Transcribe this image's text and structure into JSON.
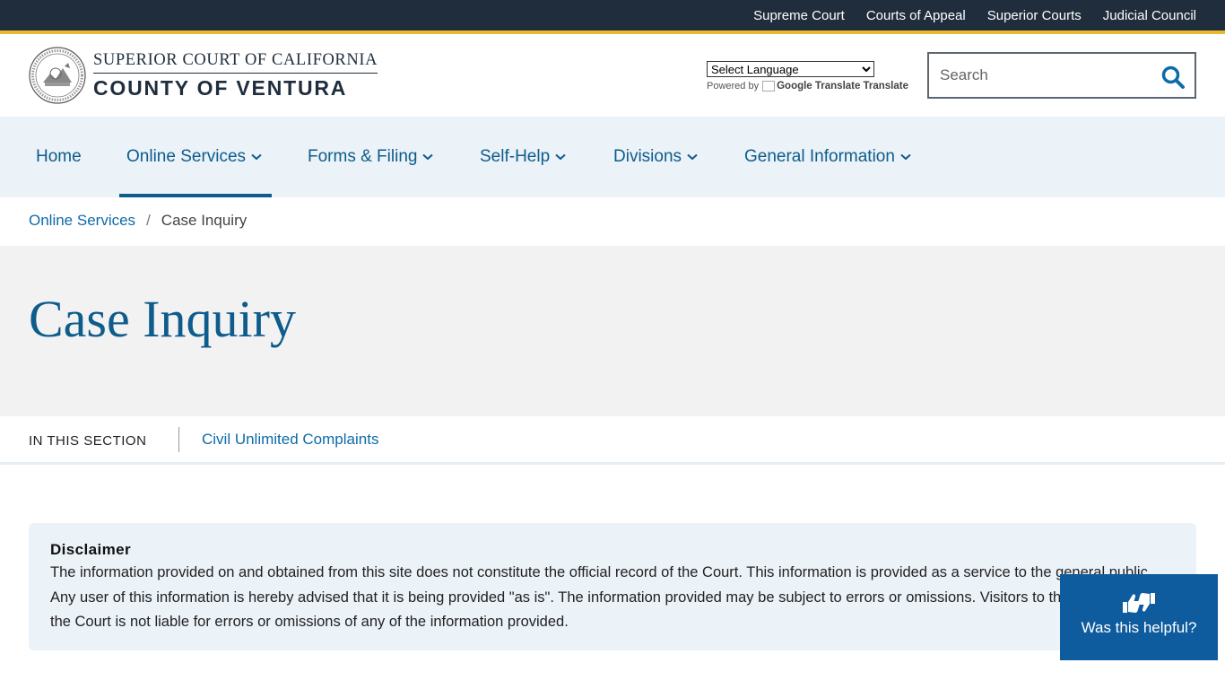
{
  "topbar": {
    "links": [
      "Supreme Court",
      "Courts of Appeal",
      "Superior Courts",
      "Judicial Council"
    ]
  },
  "header": {
    "logo_line1": "SUPERIOR COURT OF CALIFORNIA",
    "logo_line2": "COUNTY OF VENTURA",
    "language_select_value": "Select Language",
    "powered_by": "Powered by",
    "google_translate_alt": "Google Translate",
    "translate_label": "Translate",
    "search_placeholder": "Search"
  },
  "nav": {
    "items": [
      "Home",
      "Online Services",
      "Forms & Filing",
      "Self-Help",
      "Divisions",
      "General Information"
    ],
    "active": "Online Services"
  },
  "breadcrumb": {
    "parent": "Online Services",
    "separator": "/",
    "current": "Case Inquiry"
  },
  "page": {
    "title": "Case Inquiry"
  },
  "section": {
    "label": "IN THIS SECTION",
    "link": "Civil Unlimited Complaints"
  },
  "disclaimer": {
    "heading": "Disclaimer",
    "text": "The information provided on and obtained from this site does not constitute the official record of the Court. This information is provided as a service to the general public. Any user of this information is hereby advised that it is being provided \"as is\". The information provided may be subject to errors or omissions. Visitors to this site agree that the Court is not liable for errors or omissions of any of the information provided."
  },
  "feedback": {
    "label": "Was this helpful?"
  },
  "colors": {
    "topbar": "#1f2d3d",
    "accent": "#e8b931",
    "link": "#0e5c8c",
    "nav_bg": "#ebf2f8",
    "feedback_bg": "#0e5c9e"
  }
}
